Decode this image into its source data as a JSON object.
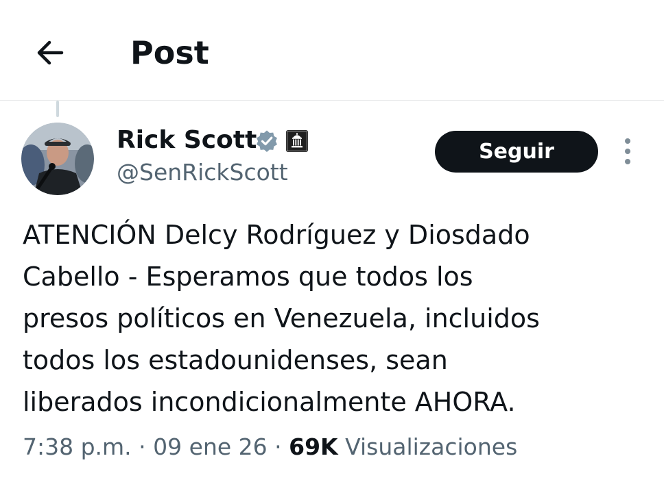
{
  "header": {
    "title": "Post",
    "back_icon": "arrow-left-icon"
  },
  "author": {
    "name": "Rick Scott",
    "handle": "@SenRickScott",
    "verified_icon": "verified-badge-icon",
    "affiliation_icon": "government-badge-icon",
    "verified_color": "#829aab"
  },
  "actions": {
    "follow_label": "Seguir",
    "more_icon": "more-vertical-icon"
  },
  "post": {
    "lines": [
      "ATENCIÓN Delcy Rodríguez y Diosdado",
      "Cabello - Esperamos que todos los",
      "presos políticos en Venezuela, incluidos",
      "todos los estadounidenses, sean",
      "liberados incondicionalmente AHORA."
    ]
  },
  "meta": {
    "time": "7:38 p.m.",
    "separator": " · ",
    "date": "09 ene 26",
    "views_count": "69K",
    "views_label": "Visualizaciones"
  },
  "colors": {
    "text_primary": "#0f1419",
    "text_secondary": "#536471",
    "button_bg": "#0f1419",
    "divider": "#e7e9ea"
  }
}
